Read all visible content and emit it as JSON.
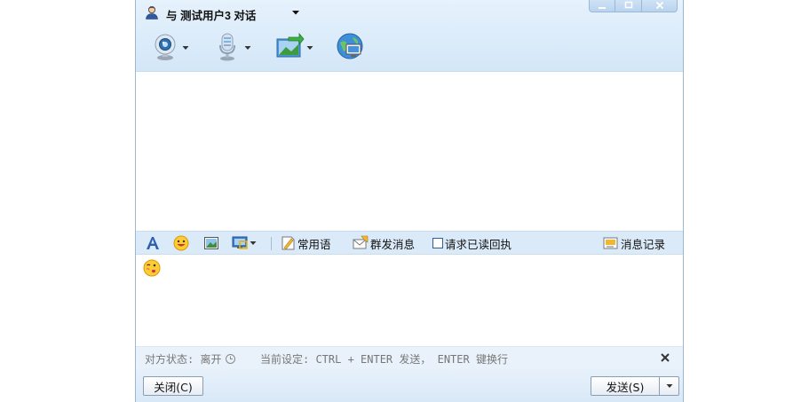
{
  "window": {
    "title": "与  测试用户3  对话",
    "title_icon": "user-icon"
  },
  "toolbar": {
    "items": [
      {
        "name": "video-chat",
        "icon": "webcam-icon",
        "has_dropdown": true
      },
      {
        "name": "voice-chat",
        "icon": "microphone-icon",
        "has_dropdown": true
      },
      {
        "name": "send-file",
        "icon": "file-transfer-icon",
        "has_dropdown": true
      },
      {
        "name": "remote-assist",
        "icon": "remote-desktop-icon",
        "has_dropdown": false
      }
    ]
  },
  "edit_toolbar": {
    "font_icon": "font-icon",
    "emoji_icon": "emoji-icon",
    "image_icon": "image-icon",
    "screen_icon": "screenshot-icon",
    "common_phrases": "常用语",
    "group_send": "群发消息",
    "read_receipt": "请求已读回执",
    "read_receipt_checked": false,
    "history": "消息记录"
  },
  "status": {
    "peer_status": "对方状态: 离开",
    "current_setting": "当前设定: CTRL + ENTER 发送， ENTER 键换行"
  },
  "buttons": {
    "close": "关闭(C)",
    "send": "发送(S)"
  },
  "colors": {
    "titlebar_bg": "#dcecfa",
    "toolbar_bg": "#dbeaf8",
    "statusbar_bg": "#e9f2fb",
    "border": "#9fb6cf"
  }
}
